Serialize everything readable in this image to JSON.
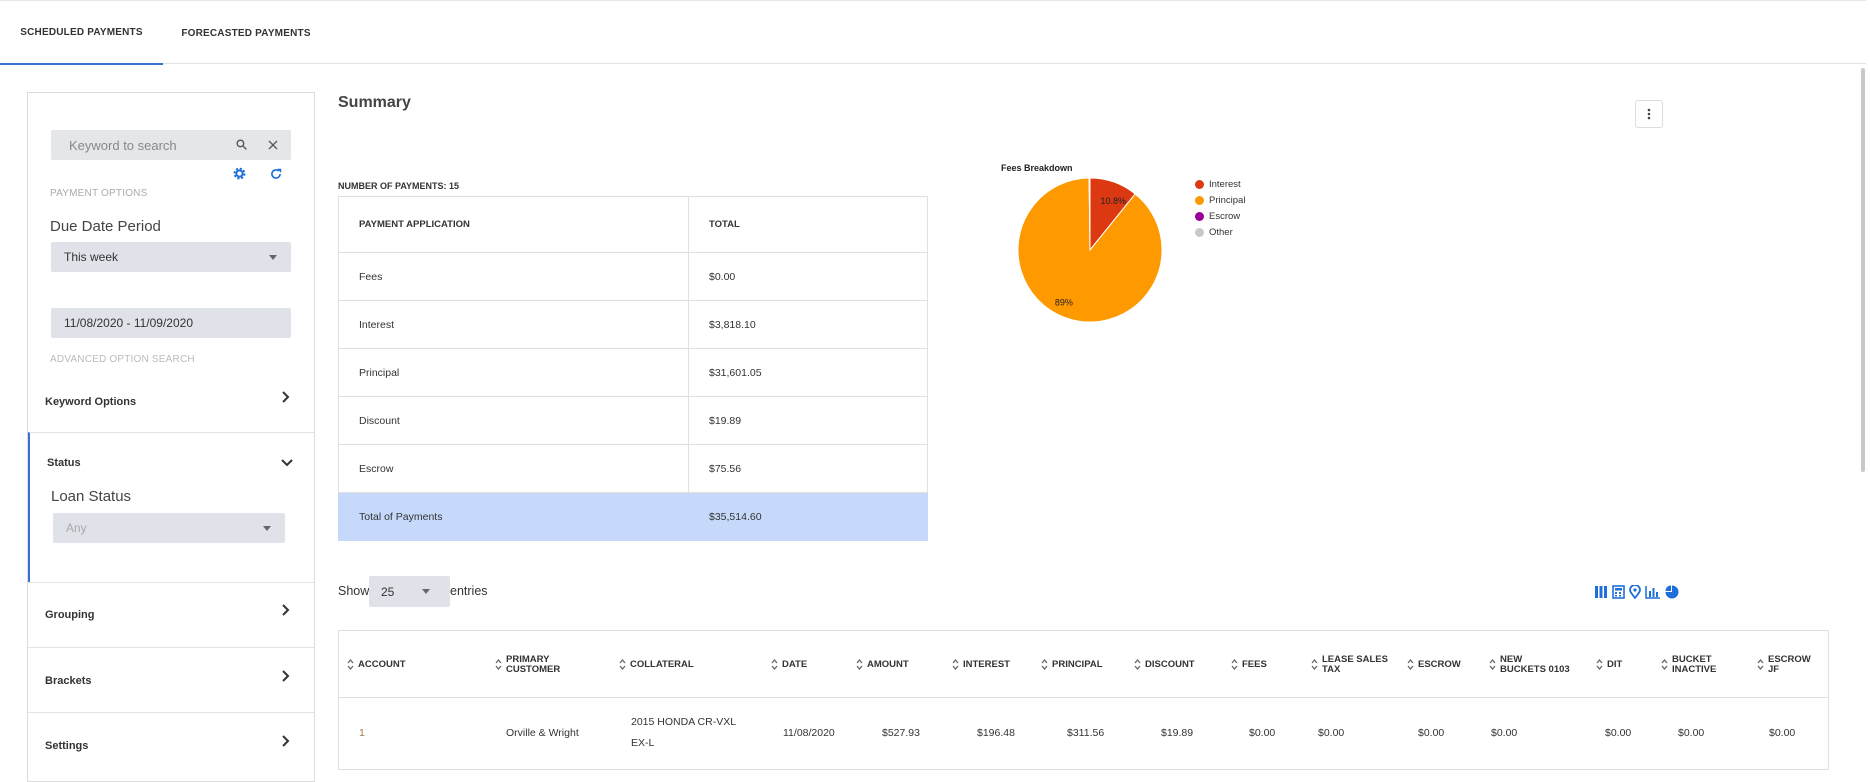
{
  "tabs": [
    {
      "label": "SCHEDULED PAYMENTS",
      "active": true
    },
    {
      "label": "FORECASTED PAYMENTS",
      "active": false
    }
  ],
  "filters": {
    "search_placeholder": "Keyword to search",
    "payment_options_label": "PAYMENT OPTIONS",
    "due_date_label": "Due Date Period",
    "due_date_value": "This week",
    "date_range": "11/08/2020 - 11/09/2020",
    "advanced_label": "ADVANCED OPTION SEARCH",
    "sections": {
      "keyword_options": "Keyword Options",
      "status": "Status",
      "grouping": "Grouping",
      "brackets": "Brackets",
      "settings": "Settings"
    },
    "loan_status_label": "Loan Status",
    "loan_status_value": "Any"
  },
  "summary": {
    "title": "Summary",
    "number_of_payments": "NUMBER OF PAYMENTS: 15",
    "columns": [
      "PAYMENT APPLICATION",
      "TOTAL"
    ],
    "rows": [
      {
        "label": "Fees",
        "total": "$0.00"
      },
      {
        "label": "Interest",
        "total": "$3,818.10"
      },
      {
        "label": "Principal",
        "total": "$31,601.05"
      },
      {
        "label": "Discount",
        "total": "$19.89"
      },
      {
        "label": "Escrow",
        "total": "$75.56"
      }
    ],
    "total_row": {
      "label": "Total of Payments",
      "total": "$35,514.60"
    }
  },
  "chart_data": {
    "type": "pie",
    "title": "Fees Breakdown",
    "categories": [
      "Interest",
      "Principal",
      "Escrow",
      "Other"
    ],
    "values": [
      10.8,
      89,
      0.2,
      0
    ],
    "slice_labels": [
      "10.8%",
      "89%"
    ],
    "colors": [
      "#dc3912",
      "#ff9900",
      "#990099",
      "#c8c8c8"
    ],
    "legend": "right"
  },
  "entries": {
    "show_label": "Show",
    "value": "25",
    "entries_label": "entries"
  },
  "toolbar_icons": [
    "columns-icon",
    "calculator-icon",
    "map-pin-icon",
    "bar-chart-icon",
    "pie-chart-icon"
  ],
  "grid": {
    "headers": [
      "ACCOUNT",
      "PRIMARY CUSTOMER",
      "COLLATERAL",
      "DATE",
      "AMOUNT",
      "INTEREST",
      "PRINCIPAL",
      "DISCOUNT",
      "FEES",
      "LEASE SALES TAX",
      "ESCROW",
      "NEW BUCKETS 0103",
      "DIT",
      "BUCKET INACTIVE",
      "ESCROW JF"
    ],
    "rows": [
      [
        "1",
        "Orville & Wright",
        "2015 HONDA CR-VXL EX-L",
        "11/08/2020",
        "$527.93",
        "$196.48",
        "$311.56",
        "$19.89",
        "$0.00",
        "$0.00",
        "$0.00",
        "$0.00",
        "$0.00",
        "$0.00",
        "$0.00"
      ]
    ]
  },
  "colors": {
    "accent": "#3b6fd0",
    "total_row": "#c6d9fb",
    "link": "#a07a3a"
  }
}
